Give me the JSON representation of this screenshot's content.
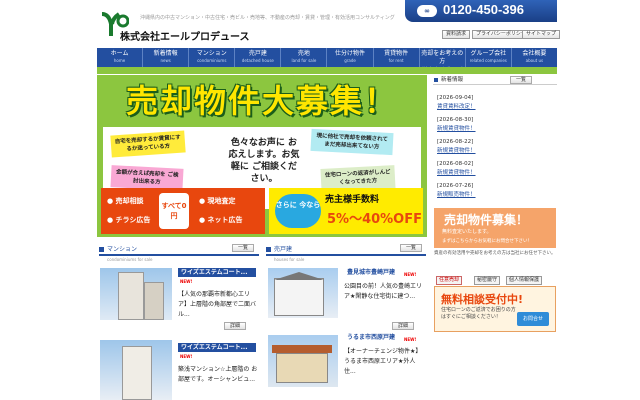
{
  "header": {
    "tagline": "沖縄県内の中古マンション・中古住宅・売ビル・売地等、不動産の売却・賃貸・管理・有効活用コンサルティング",
    "company": "株式会社エールプロデュース",
    "phone": "0120-450-396",
    "util_links": [
      "資料請求",
      "プライバシーポリシー",
      "サイトマップ"
    ]
  },
  "nav": [
    {
      "jp": "ホーム",
      "en": "home"
    },
    {
      "jp": "新着情報",
      "en": "news"
    },
    {
      "jp": "マンション",
      "en": "condominiums"
    },
    {
      "jp": "売戸建",
      "en": "detached house"
    },
    {
      "jp": "売地",
      "en": "land for sale"
    },
    {
      "jp": "仕分け物件",
      "en": "grade"
    },
    {
      "jp": "賃貸物件",
      "en": "for rent"
    },
    {
      "jp": "売却をお考えの方",
      "en": "think about disposal"
    },
    {
      "jp": "グループ会社",
      "en": "related companies"
    },
    {
      "jp": "会社概要",
      "en": "about us"
    }
  ],
  "banner": {
    "title": "売却物件大募集！",
    "note1": "自宅を売却するか賃貸にするか迷っている方",
    "note2": "金額が合えば売却を ご検討出来る方",
    "note3": "現に他社で売却を依頼されてまだ売却出来てない方",
    "note4": "住宅ローンの返済がしんどくなってきた方",
    "center": "色々なお声に お応えします。お気軽に ご相談ください。",
    "red_items": [
      "売却相談",
      "チラシ広告",
      "現地査定",
      "ネット広告"
    ],
    "zero_label": "すべて0円",
    "bubble": "さらに 今なら",
    "yellow_t1": "売主様手数料",
    "yellow_t2": "5%～40%OFF"
  },
  "mansion": {
    "heading": "マンション",
    "sub": "condominiums for sale",
    "more": "一覧",
    "items": [
      {
        "title": "ワイズエステムコート...",
        "new": "NEW!",
        "desc": "【人気の那覇市新都心エリア】上層階の角部屋で二面バル...",
        "more": "詳細"
      },
      {
        "title": "ワイズエステムコート...",
        "new": "NEW!",
        "desc": "築浅マンション☆上層階の お部屋です。オーシャンビュ...",
        "more": "詳細"
      }
    ]
  },
  "house": {
    "heading": "売戸建",
    "sub": "houses for sale",
    "more": "一覧",
    "items": [
      {
        "title": "豊見城市豊崎戸建",
        "new": "NEW!",
        "desc": "公園目の前！人気の豊崎エリア★閑静な住宅街に建つ...",
        "more": "詳細"
      },
      {
        "title": "うるま市西原戸建",
        "new": "NEW!",
        "desc": "【オーナーチェンジ物件★】うるま市西原エリア★外人住...",
        "more": "詳細"
      }
    ]
  },
  "sidebar": {
    "news_heading": "新着情報",
    "news_more": "一覧",
    "news": [
      {
        "date": "[2026-09-04]",
        "link": "賃貸賃料改定！"
      },
      {
        "date": "[2026-08-30]",
        "link": "新規賃貸物件！"
      },
      {
        "date": "[2026-08-22]",
        "link": "新規賃貸物件！"
      },
      {
        "date": "[2026-08-02]",
        "link": "新規賃貸物件！"
      },
      {
        "date": "[2026-07-26]",
        "link": "新規販売物件！"
      }
    ],
    "banner1_title": "売却物件募集！",
    "banner1_sub": "無料査定いたします。",
    "banner1_sub2": "まずはこちらからお気軽にお問合せ下さい！",
    "banner1_note": "資産の有効活用や売却をお考えの方は当社にお任せ下さい。",
    "tags": [
      "任意売却",
      "秘密厳守",
      "個人情報保護"
    ],
    "banner2_title": "無料相談受付中!",
    "banner2_sub": "住宅ローンのご返済でお困りの方はすぐにご相談ください！",
    "banner2_btn": "お問合せ"
  },
  "colors": {
    "nav_blue": "#234fa0",
    "green": "#8cc63f",
    "orange": "#e8470e",
    "yellow": "#ffeb00"
  }
}
